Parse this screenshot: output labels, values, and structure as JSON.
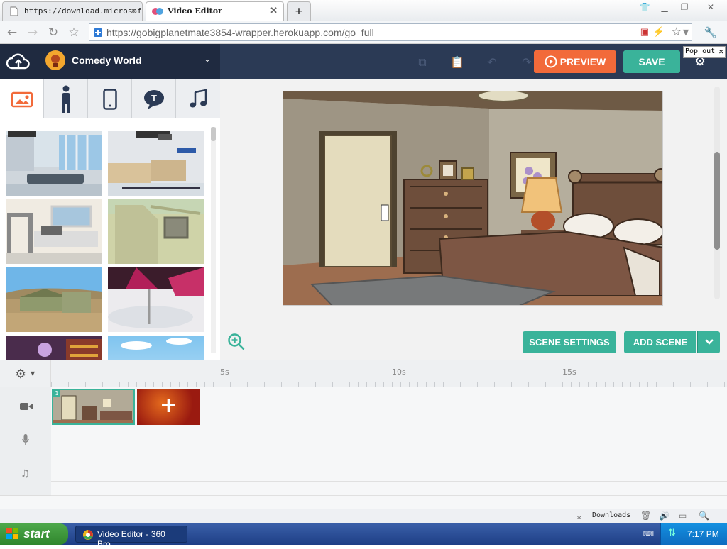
{
  "browser": {
    "tabs": [
      {
        "title": "https://download.microsof",
        "active": false
      },
      {
        "title": "Video Editor",
        "active": true
      }
    ],
    "new_tab": "+",
    "url": "https://gobigplanetmate3854-wrapper.herokuapp.com/go_full",
    "popout": "Pop out"
  },
  "app": {
    "project_name": "Comedy World",
    "preview_label": "PREVIEW",
    "save_label": "SAVE",
    "accent_orange": "#f26a3a",
    "accent_teal": "#3ab39a",
    "header_color": "#2b3a55"
  },
  "left_panel": {
    "tabs": [
      "image-icon",
      "character-icon",
      "prop-icon",
      "text-icon",
      "music-icon"
    ]
  },
  "stage": {
    "scene_settings_label": "SCENE SETTINGS",
    "add_scene_label": "ADD SCENE"
  },
  "timeline": {
    "ticks": [
      "5s",
      "10s",
      "15s"
    ],
    "scene_number": "1",
    "add_symbol": "+"
  },
  "status": {
    "downloads": "Downloads"
  },
  "taskbar": {
    "start": "start",
    "task": "Video Editor - 360 Bro...",
    "clock": "7:17 PM"
  }
}
